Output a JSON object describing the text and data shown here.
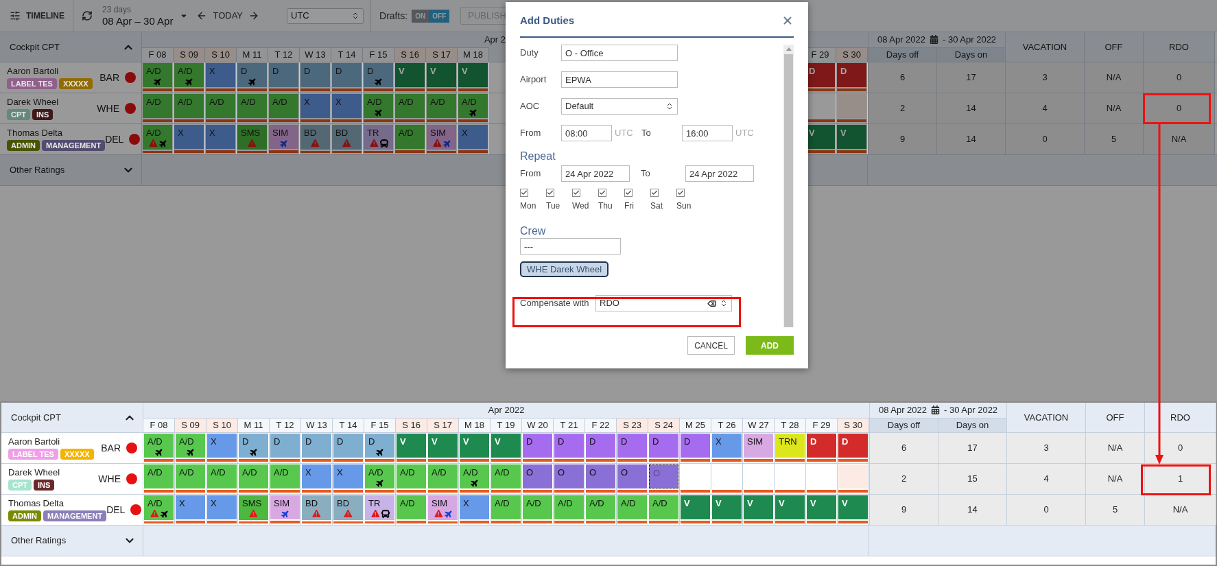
{
  "toolbar": {
    "view": "TIMELINE",
    "span": "23 days",
    "range": "08 Apr – 30 Apr",
    "today": "TODAY",
    "timezone": "UTC",
    "drafts_label": "Drafts:",
    "drafts": [
      {
        "label": "ON",
        "selected": false
      },
      {
        "label": "OFF",
        "selected": true
      }
    ],
    "publish": {
      "label": "PUBLISH",
      "disabled": true
    }
  },
  "top": {
    "group": "Cockpit CPT",
    "month": "Apr 2",
    "range_start": "08 Apr 2022",
    "range_end": "- 30 Apr 2022",
    "sub_columns": [
      "Days off",
      "Days on"
    ],
    "columns": [
      "VACATION",
      "OFF",
      "RDO"
    ],
    "other": "Other Ratings",
    "days_left": [
      {
        "label": "F 08",
        "weekend": false
      },
      {
        "label": "S 09",
        "weekend": true
      },
      {
        "label": "S 10",
        "weekend": true
      },
      {
        "label": "M 11",
        "weekend": false
      },
      {
        "label": "T 12",
        "weekend": false
      },
      {
        "label": "W 13",
        "weekend": false
      },
      {
        "label": "T 14",
        "weekend": false
      },
      {
        "label": "F 15",
        "weekend": false
      },
      {
        "label": "S 16",
        "weekend": true
      },
      {
        "label": "S 17",
        "weekend": true
      },
      {
        "label": "M 18",
        "weekend": false
      }
    ],
    "days_right": [
      {
        "label": "F 29",
        "weekend": false
      },
      {
        "label": "S 30",
        "weekend": true
      }
    ],
    "rows": [
      {
        "name": "Aaron Bartoli",
        "tags": [
          {
            "label": "LABEL TES",
            "color": "#915f8b"
          },
          {
            "label": "XXXXX",
            "color": "#926c00"
          }
        ],
        "code": "BAR",
        "status": {
          "color": "#8b0a0a"
        },
        "cells_left": [
          {
            "text": "A/D",
            "color": "#34782e",
            "icons": [
              {
                "kind": "plane"
              }
            ]
          },
          {
            "text": "A/D",
            "color": "#34782e",
            "icons": [
              {
                "kind": "plane"
              }
            ]
          },
          {
            "text": "X",
            "color": "#3d5c8b"
          },
          {
            "text": "D",
            "color": "#4c687d",
            "icons": [
              {
                "kind": "plane"
              }
            ]
          },
          {
            "text": "D",
            "color": "#4c687d"
          },
          {
            "text": "D",
            "color": "#4c687d"
          },
          {
            "text": "D",
            "color": "#4c687d"
          },
          {
            "text": "D",
            "color": "#4c687d",
            "icons": [
              {
                "kind": "plane"
              }
            ]
          },
          {
            "text": "V",
            "color": "#125330"
          },
          {
            "text": "V",
            "color": "#125330"
          },
          {
            "text": "V",
            "color": "#125330"
          }
        ],
        "cells_right": [
          {
            "text": "D",
            "color": "#7f1919"
          },
          {
            "text": "D",
            "color": "#7f1919"
          }
        ],
        "stats": [
          "6",
          "17",
          "3",
          "N/A",
          "0"
        ]
      },
      {
        "name": "Darek Wheel",
        "tags": [
          {
            "label": "CPT",
            "color": "#64887d"
          },
          {
            "label": "INS",
            "color": "#401919"
          }
        ],
        "code": "WHE",
        "status": {
          "color": "#8b0a0a"
        },
        "cells_left": [
          {
            "text": "A/D",
            "color": "#34782e"
          },
          {
            "text": "A/D",
            "color": "#34782e"
          },
          {
            "text": "A/D",
            "color": "#34782e"
          },
          {
            "text": "A/D",
            "color": "#34782e"
          },
          {
            "text": "A/D",
            "color": "#34782e"
          },
          {
            "text": "X",
            "color": "#3d5c8b"
          },
          {
            "text": "X",
            "color": "#3d5c8b"
          },
          {
            "text": "A/D",
            "color": "#34782e",
            "icons": [
              {
                "kind": "plane"
              }
            ]
          },
          {
            "text": "A/D",
            "color": "#34782e"
          },
          {
            "text": "A/D",
            "color": "#34782e"
          },
          {
            "text": "A/D",
            "color": "#34782e",
            "icons": [
              {
                "kind": "plane"
              }
            ]
          }
        ],
        "cells_right": [
          {
            "selected": false
          },
          {
            "color": "#978d89"
          }
        ],
        "stats": [
          "2",
          "14",
          "4",
          "N/A",
          "0"
        ]
      },
      {
        "name": "Thomas Delta",
        "tags": [
          {
            "label": "ADMIN",
            "color": "#495300"
          },
          {
            "label": "MANAGEMENT",
            "color": "#534c6e"
          }
        ],
        "code": "DEL",
        "status": {
          "color": "#8b0a0a"
        },
        "cells_left": [
          {
            "text": "A/D",
            "color": "#34782e",
            "icons": [
              {
                "kind": "warning"
              },
              {
                "kind": "plane"
              }
            ]
          },
          {
            "text": "X",
            "color": "#3d5c8b"
          },
          {
            "text": "X",
            "color": "#3d5c8b"
          },
          {
            "text": "SMS",
            "color": "#2e6e26",
            "icons": [
              {
                "kind": "warning"
              }
            ]
          },
          {
            "text": "SIM",
            "color": "#826588",
            "icons": [
              {
                "kind": "plane-blue"
              }
            ]
          },
          {
            "text": "BD",
            "color": "#536873",
            "icons": [
              {
                "kind": "warning"
              }
            ]
          },
          {
            "text": "BD",
            "color": "#536873",
            "icons": [
              {
                "kind": "warning"
              }
            ]
          },
          {
            "text": "TR",
            "color": "#776b8b",
            "icons": [
              {
                "kind": "warning"
              },
              {
                "kind": "bus"
              }
            ]
          },
          {
            "text": "A/D",
            "color": "#34782e"
          },
          {
            "text": "SIM",
            "color": "#826588",
            "icons": [
              {
                "kind": "warning"
              },
              {
                "kind": "plane-blue"
              }
            ]
          },
          {
            "text": "X",
            "color": "#3d5c8b"
          }
        ],
        "cells_right": [
          {
            "text": "V",
            "color": "#125330"
          },
          {
            "text": "V",
            "color": "#125330"
          }
        ],
        "stats": [
          "9",
          "14",
          "0",
          "5",
          "N/A"
        ]
      }
    ]
  },
  "dialog": {
    "title": "Add Duties",
    "duty_label": "Duty",
    "duty": "O - Office",
    "airport_label": "Airport",
    "airport": "EPWA",
    "aoc_label": "AOC",
    "aoc": "Default",
    "from_label": "From",
    "from": "08:00",
    "from_unit": "UTC",
    "to_label": "To",
    "to": "16:00",
    "to_unit": "UTC",
    "repeat": "Repeat",
    "repeat_from_label": "From",
    "repeat_from": "24 Apr 2022",
    "repeat_to_label": "To",
    "repeat_to": "24 Apr 2022",
    "weekdays": [
      {
        "label": "Mon",
        "checked": true
      },
      {
        "label": "Tue",
        "checked": true
      },
      {
        "label": "Wed",
        "checked": true
      },
      {
        "label": "Thu",
        "checked": true
      },
      {
        "label": "Fri",
        "checked": true
      },
      {
        "label": "Sat",
        "checked": true
      },
      {
        "label": "Sun",
        "checked": true
      }
    ],
    "crew": "Crew",
    "crew_value": "---",
    "crew_chip": "WHE Darek Wheel",
    "compensate_label": "Compensate with",
    "compensate": "RDO",
    "cancel": "CANCEL",
    "add": "ADD"
  },
  "bottom": {
    "group": "Cockpit CPT",
    "month": "Apr 2022",
    "range_start": "08 Apr 2022",
    "range_end": "- 30 Apr 2022",
    "sub_columns": [
      "Days off",
      "Days on"
    ],
    "columns": [
      "VACATION",
      "OFF",
      "RDO"
    ],
    "other": "Other Ratings",
    "days": [
      {
        "label": "F 08",
        "weekend": false
      },
      {
        "label": "S 09",
        "weekend": true
      },
      {
        "label": "S 10",
        "weekend": true
      },
      {
        "label": "M 11",
        "weekend": false
      },
      {
        "label": "T 12",
        "weekend": false
      },
      {
        "label": "W 13",
        "weekend": false
      },
      {
        "label": "T 14",
        "weekend": false
      },
      {
        "label": "F 15",
        "weekend": false
      },
      {
        "label": "S 16",
        "weekend": true
      },
      {
        "label": "S 17",
        "weekend": true
      },
      {
        "label": "M 18",
        "weekend": false
      },
      {
        "label": "T 19",
        "weekend": false
      },
      {
        "label": "W 20",
        "weekend": false
      },
      {
        "label": "T 21",
        "weekend": false
      },
      {
        "label": "F 22",
        "weekend": false
      },
      {
        "label": "S 23",
        "weekend": true
      },
      {
        "label": "S 24",
        "weekend": true
      },
      {
        "label": "M 25",
        "weekend": false
      },
      {
        "label": "T 26",
        "weekend": false
      },
      {
        "label": "W 27",
        "weekend": false
      },
      {
        "label": "T 28",
        "weekend": false
      },
      {
        "label": "F 29",
        "weekend": false
      },
      {
        "label": "S 30",
        "weekend": true
      }
    ],
    "rows": [
      {
        "name": "Aaron Bartoli",
        "tags": [
          {
            "label": "LABEL TES",
            "color": "#f19ee8"
          },
          {
            "label": "XXXXX",
            "color": "#f4b400"
          }
        ],
        "code": "BAR",
        "status": {
          "color": "#e81111"
        },
        "cells": [
          {
            "text": "A/D",
            "color": "#57c84d",
            "icons": [
              {
                "kind": "plane"
              }
            ],
            "selected": false
          },
          {
            "text": "A/D",
            "color": "#57c84d",
            "icons": [
              {
                "kind": "plane"
              }
            ],
            "selected": false
          },
          {
            "text": "X",
            "color": "#6699e8",
            "selected": false
          },
          {
            "text": "D",
            "color": "#7eaed0",
            "icons": [
              {
                "kind": "plane"
              }
            ],
            "selected": false
          },
          {
            "text": "D",
            "color": "#7eaed0",
            "selected": false
          },
          {
            "text": "D",
            "color": "#7eaed0",
            "selected": false
          },
          {
            "text": "D",
            "color": "#7eaed0",
            "selected": false
          },
          {
            "text": "D",
            "color": "#7eaed0",
            "icons": [
              {
                "kind": "plane"
              }
            ],
            "selected": false
          },
          {
            "text": "V",
            "color": "#1e8a50",
            "selected": false
          },
          {
            "text": "V",
            "color": "#1e8a50",
            "selected": false
          },
          {
            "text": "V",
            "color": "#1e8a50",
            "selected": false
          },
          {
            "text": "V",
            "color": "#1e8a50",
            "selected": false
          },
          {
            "text": "D",
            "color": "#a66cf0",
            "selected": false
          },
          {
            "text": "D",
            "color": "#a66cf0",
            "selected": false
          },
          {
            "text": "D",
            "color": "#a66cf0",
            "selected": false
          },
          {
            "text": "D",
            "color": "#a66cf0",
            "selected": false
          },
          {
            "text": "D",
            "color": "#a66cf0",
            "selected": false
          },
          {
            "text": "D",
            "color": "#a66cf0",
            "selected": false
          },
          {
            "text": "X",
            "color": "#6699e8",
            "selected": false
          },
          {
            "text": "SIM",
            "color": "#d8a8e2",
            "selected": false
          },
          {
            "text": "TRN",
            "color": "#dde61c",
            "selected": false
          },
          {
            "text": "D",
            "color": "#d32a2a",
            "selected": false
          },
          {
            "text": "D",
            "color": "#d32a2a",
            "selected": false
          }
        ],
        "stats": [
          "6",
          "17",
          "3",
          "N/A",
          "0"
        ]
      },
      {
        "name": "Darek Wheel",
        "tags": [
          {
            "label": "CPT",
            "color": "#a6e3d0"
          },
          {
            "label": "INS",
            "color": "#6b2a2a"
          }
        ],
        "code": "WHE",
        "status": {
          "color": "#e81111"
        },
        "cells": [
          {
            "text": "A/D",
            "color": "#57c84d",
            "selected": false
          },
          {
            "text": "A/D",
            "color": "#57c84d",
            "selected": false
          },
          {
            "text": "A/D",
            "color": "#57c84d",
            "selected": false
          },
          {
            "text": "A/D",
            "color": "#57c84d",
            "selected": false
          },
          {
            "text": "A/D",
            "color": "#57c84d",
            "selected": false
          },
          {
            "text": "X",
            "color": "#6699e8",
            "selected": false
          },
          {
            "text": "X",
            "color": "#6699e8",
            "selected": false
          },
          {
            "text": "A/D",
            "color": "#57c84d",
            "icons": [
              {
                "kind": "plane"
              }
            ],
            "selected": false
          },
          {
            "text": "A/D",
            "color": "#57c84d",
            "selected": false
          },
          {
            "text": "A/D",
            "color": "#57c84d",
            "selected": false
          },
          {
            "text": "A/D",
            "color": "#57c84d",
            "icons": [
              {
                "kind": "plane"
              }
            ],
            "selected": false
          },
          {
            "text": "A/D",
            "color": "#57c84d",
            "selected": false
          },
          {
            "text": "O",
            "color": "#8a6fd6",
            "selected": false
          },
          {
            "text": "O",
            "color": "#8a6fd6",
            "selected": false
          },
          {
            "text": "O",
            "color": "#8a6fd6",
            "selected": false
          },
          {
            "text": "O",
            "color": "#8a6fd6",
            "selected": false
          },
          {
            "text": "O",
            "color": "#8a6fd6",
            "selected": true
          },
          {
            "selected": false
          },
          {
            "selected": false
          },
          {
            "selected": false
          },
          {
            "selected": false
          },
          {
            "selected": false
          },
          {
            "color": "#fcebe5",
            "selected": false
          }
        ],
        "stats": [
          "2",
          "15",
          "4",
          "N/A",
          "1"
        ]
      },
      {
        "name": "Thomas Delta",
        "tags": [
          {
            "label": "ADMIN",
            "color": "#7a8a00"
          },
          {
            "label": "MANAGEMENT",
            "color": "#8b7fb8"
          }
        ],
        "code": "DEL",
        "status": {
          "color": "#e81111"
        },
        "cells": [
          {
            "text": "A/D",
            "color": "#57c84d",
            "icons": [
              {
                "kind": "warning"
              },
              {
                "kind": "plane"
              }
            ],
            "selected": false
          },
          {
            "text": "X",
            "color": "#6699e8",
            "selected": false
          },
          {
            "text": "X",
            "color": "#6699e8",
            "selected": false
          },
          {
            "text": "SMS",
            "color": "#4cb83f",
            "icons": [
              {
                "kind": "warning"
              }
            ],
            "selected": false
          },
          {
            "text": "SIM",
            "color": "#d8a8e2",
            "icons": [
              {
                "kind": "plane-blue"
              }
            ],
            "selected": false
          },
          {
            "text": "BD",
            "color": "#8aaec0",
            "icons": [
              {
                "kind": "warning"
              }
            ],
            "selected": false
          },
          {
            "text": "BD",
            "color": "#8aaec0",
            "icons": [
              {
                "kind": "warning"
              }
            ],
            "selected": false
          },
          {
            "text": "TR",
            "color": "#c7b3e8",
            "icons": [
              {
                "kind": "warning"
              },
              {
                "kind": "bus"
              }
            ],
            "selected": false
          },
          {
            "text": "A/D",
            "color": "#57c84d",
            "selected": false
          },
          {
            "text": "SIM",
            "color": "#d8a8e2",
            "icons": [
              {
                "kind": "warning"
              },
              {
                "kind": "plane-blue"
              }
            ],
            "selected": false
          },
          {
            "text": "X",
            "color": "#6699e8",
            "selected": false
          },
          {
            "text": "A/D",
            "color": "#57c84d",
            "selected": false
          },
          {
            "text": "A/D",
            "color": "#57c84d",
            "selected": false
          },
          {
            "text": "A/D",
            "color": "#57c84d",
            "selected": false
          },
          {
            "text": "A/D",
            "color": "#57c84d",
            "selected": false
          },
          {
            "text": "A/D",
            "color": "#57c84d",
            "selected": false
          },
          {
            "text": "A/D",
            "color": "#57c84d",
            "selected": false
          },
          {
            "text": "V",
            "color": "#1e8a50",
            "selected": false
          },
          {
            "text": "V",
            "color": "#1e8a50",
            "selected": false
          },
          {
            "text": "V",
            "color": "#1e8a50",
            "selected": false
          },
          {
            "text": "V",
            "color": "#1e8a50",
            "selected": false
          },
          {
            "text": "V",
            "color": "#1e8a50",
            "selected": false
          },
          {
            "text": "V",
            "color": "#1e8a50",
            "selected": false
          }
        ],
        "stats": [
          "9",
          "14",
          "0",
          "5",
          "N/A"
        ]
      }
    ]
  }
}
